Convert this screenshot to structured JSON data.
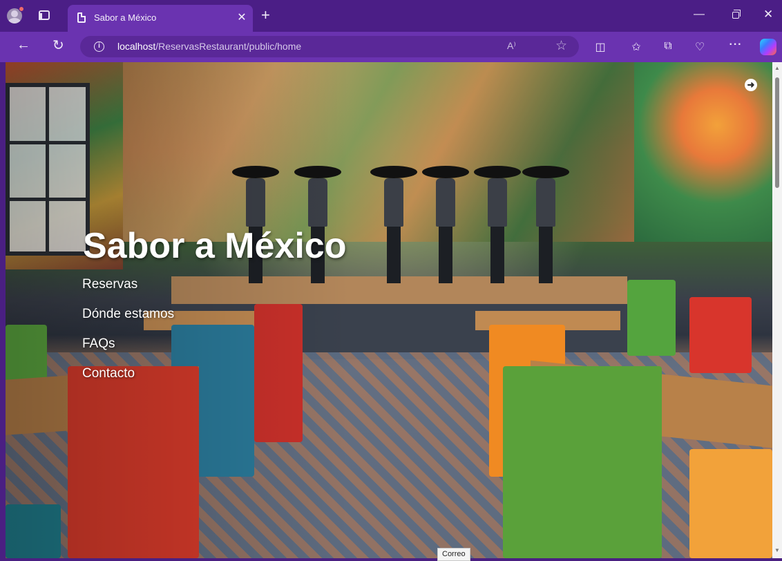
{
  "browser": {
    "tab_title": "Sabor a México",
    "new_tab_glyph": "+",
    "tab_close_glyph": "✕",
    "url_host": "localhost",
    "url_path": "/ReservasRestaurant/public/home",
    "read_aloud_glyph": "A⁾",
    "more_glyph": "···",
    "icons": [
      "profile-icon",
      "tab-actions-icon",
      "page-icon",
      "back-icon",
      "reload-icon",
      "info-icon",
      "read-aloud-icon",
      "favorite-star-icon",
      "split-screen-icon",
      "favorites-icon",
      "collections-icon",
      "browser-essentials-icon",
      "more-icon",
      "copilot-icon",
      "minimize-icon",
      "restore-icon",
      "close-icon"
    ]
  },
  "page": {
    "title": "Sabor a México",
    "nav": [
      {
        "label": "Reservas"
      },
      {
        "label": "Dónde estamos"
      },
      {
        "label": "FAQs"
      },
      {
        "label": "Contacto"
      }
    ],
    "login_glyph": "➜"
  },
  "status_tooltip": "Correo",
  "colors": {
    "frame": "#4b1e86",
    "toolbar": "#6a33b0",
    "omnibox": "#5a2898",
    "hero_text": "#ffffff"
  }
}
